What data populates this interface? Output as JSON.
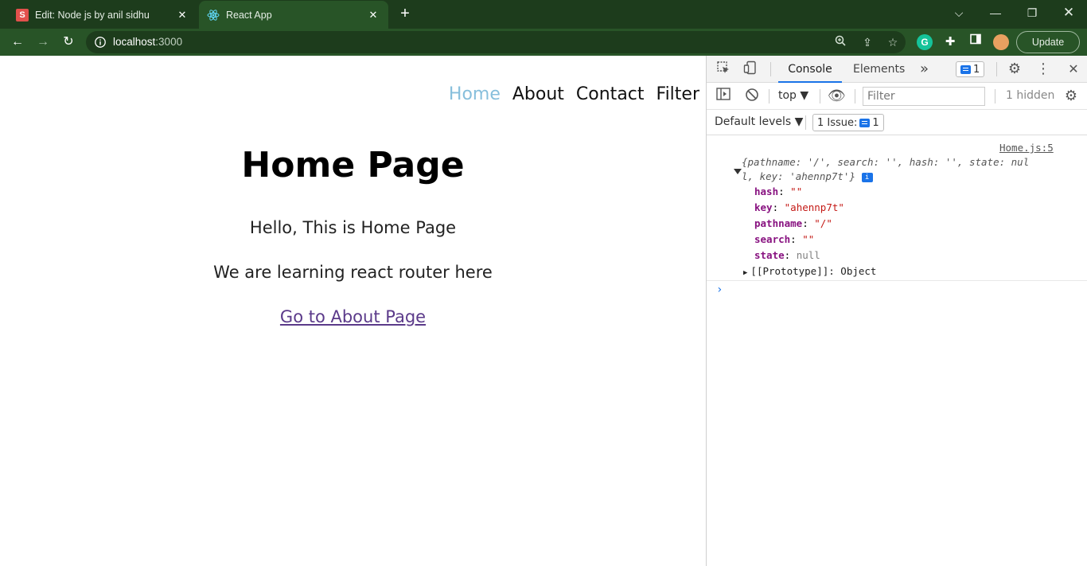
{
  "browser": {
    "tabs": [
      {
        "title": "Edit: Node js by anil sidhu",
        "favicon": "S",
        "active": false
      },
      {
        "title": "React App",
        "favicon": "react-logo",
        "active": true
      }
    ],
    "new_tab": "+",
    "address": {
      "host": "localhost",
      "port": ":3000"
    },
    "update_label": "Update",
    "colors": {
      "frame": "#1d3c1c",
      "toolbar": "#285427"
    }
  },
  "page": {
    "nav": [
      {
        "label": "Home",
        "active": true
      },
      {
        "label": "About",
        "active": false
      },
      {
        "label": "Contact",
        "active": false
      },
      {
        "label": "Filter",
        "active": false
      }
    ],
    "heading": "Home Page",
    "paragraphs": [
      "Hello, This is Home Page",
      "We are learning react router here"
    ],
    "link": "Go to About Page"
  },
  "devtools": {
    "tabs": {
      "console": "Console",
      "elements": "Elements",
      "more": "»"
    },
    "message_count": "1",
    "context": "top ▼",
    "filter_placeholder": "Filter",
    "hidden": "1 hidden",
    "levels": "Default levels ▼",
    "issues_label": "1 Issue:",
    "issues_count": "1",
    "console": {
      "source": "Home.js:5",
      "summary_part1": "{pathname: '/', search: '', hash: '', state: nul",
      "summary_part2": "l, key: 'ahennp7t'}",
      "props": [
        {
          "key": "hash",
          "value": "\"\""
        },
        {
          "key": "key",
          "value": "\"ahennp7t\""
        },
        {
          "key": "pathname",
          "value": "\"/\""
        },
        {
          "key": "search",
          "value": "\"\""
        },
        {
          "key": "state",
          "value": "null"
        }
      ],
      "prototype": "[[Prototype]]: Object"
    }
  }
}
